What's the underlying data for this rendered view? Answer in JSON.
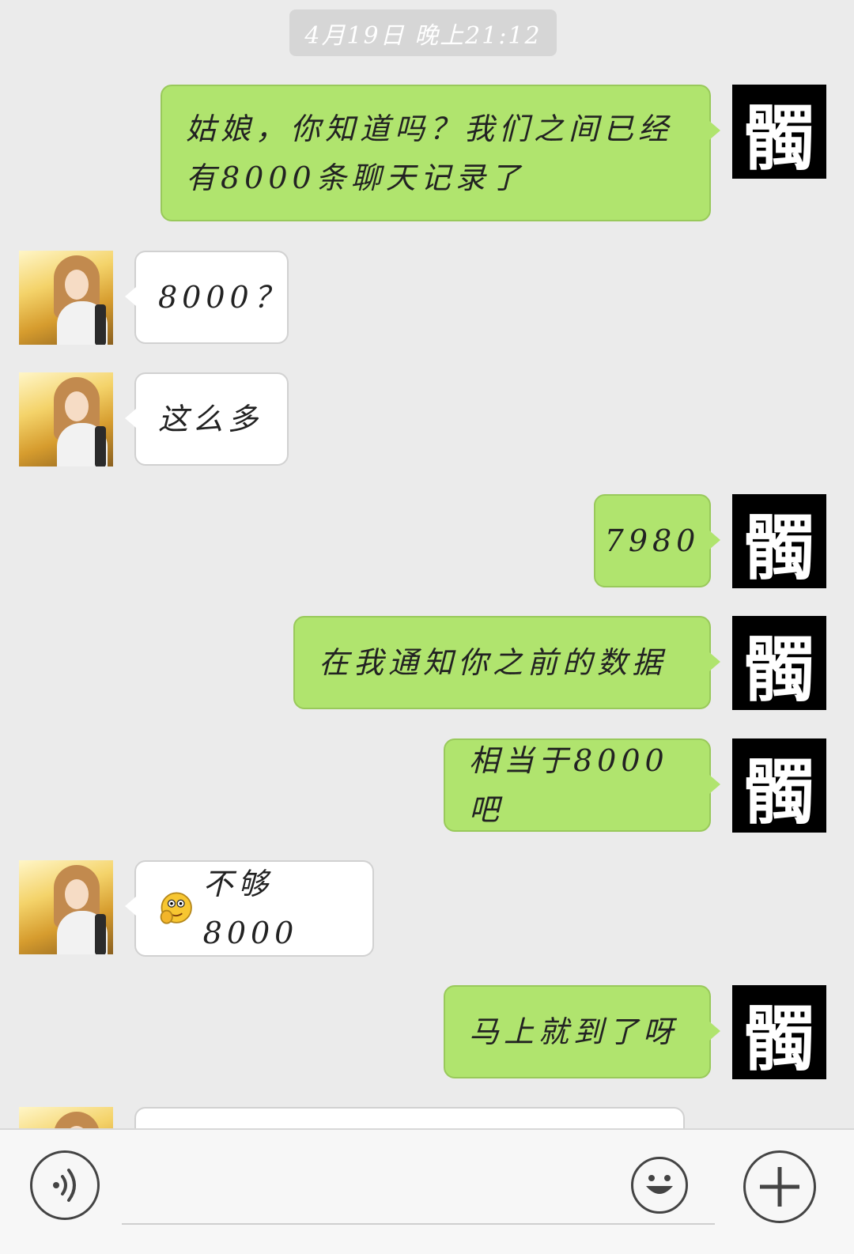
{
  "timestamp": "4月19日 晚上21:12",
  "messages": [
    {
      "sender": "me",
      "avatar_char": "髑",
      "text": "姑娘，你知道吗？我们之间已经有8000条聊天记录了"
    },
    {
      "sender": "her",
      "text": "8000？"
    },
    {
      "sender": "her",
      "text": "这么多"
    },
    {
      "sender": "me",
      "avatar_char": "髑",
      "text": "7980"
    },
    {
      "sender": "me",
      "avatar_char": "髑",
      "text": "在我通知你之前的数据"
    },
    {
      "sender": "me",
      "avatar_char": "髑",
      "text": "相当于8000吧"
    },
    {
      "sender": "her",
      "emoji": "thinking-emoji",
      "text": "不够8000"
    },
    {
      "sender": "me",
      "avatar_char": "髑",
      "text": "马上就到了呀"
    },
    {
      "sender": "her",
      "text": ""
    }
  ],
  "input_bar": {
    "voice_icon": "voice-wave-icon",
    "emoji_icon": "smiley-face-icon",
    "plus_icon": "plus-icon",
    "input_value": ""
  },
  "colors": {
    "background": "#ebebeb",
    "outgoing_bubble": "#b0e46e",
    "incoming_bubble": "#ffffff",
    "timestamp_bg": "#d6d6d6"
  }
}
